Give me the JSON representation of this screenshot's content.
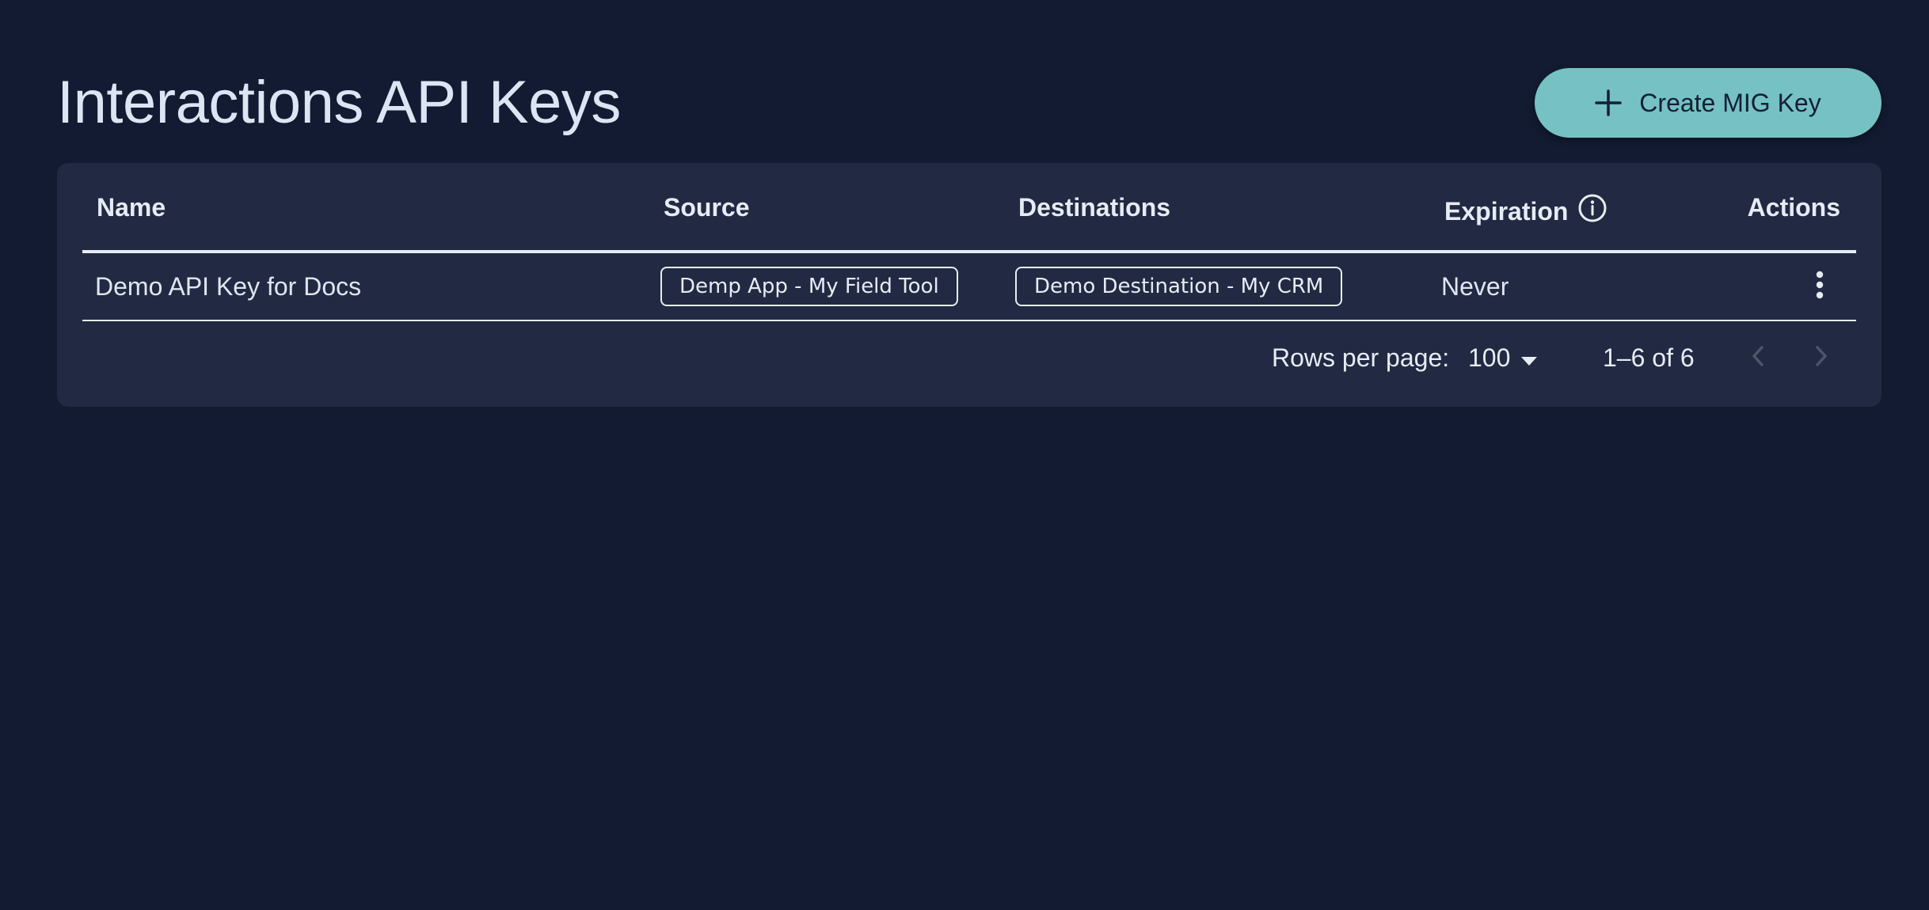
{
  "page": {
    "title": "Interactions API Keys"
  },
  "toolbar": {
    "create_label": "Create MIG Key",
    "create_icon": "plus-icon"
  },
  "table": {
    "columns": {
      "name": "Name",
      "source": "Source",
      "destinations": "Destinations",
      "expiration": "Expiration",
      "actions": "Actions"
    },
    "expiration_icon": "info-icon",
    "rows": [
      {
        "name": "Demo API Key for Docs",
        "source": "Demp App - My Field Tool",
        "destination": "Demo Destination - My CRM",
        "expiration": "Never",
        "actions_icon": "more-vertical-icon"
      }
    ]
  },
  "pagination": {
    "rows_per_page_label": "Rows per page:",
    "rows_per_page_value": "100",
    "range": "1–6 of 6",
    "prev_icon": "chevron-left-icon",
    "next_icon": "chevron-right-icon"
  },
  "colors": {
    "background": "#121b32",
    "card": "#212a42",
    "accent": "#76c1c3",
    "text": "#e6ecf5"
  }
}
